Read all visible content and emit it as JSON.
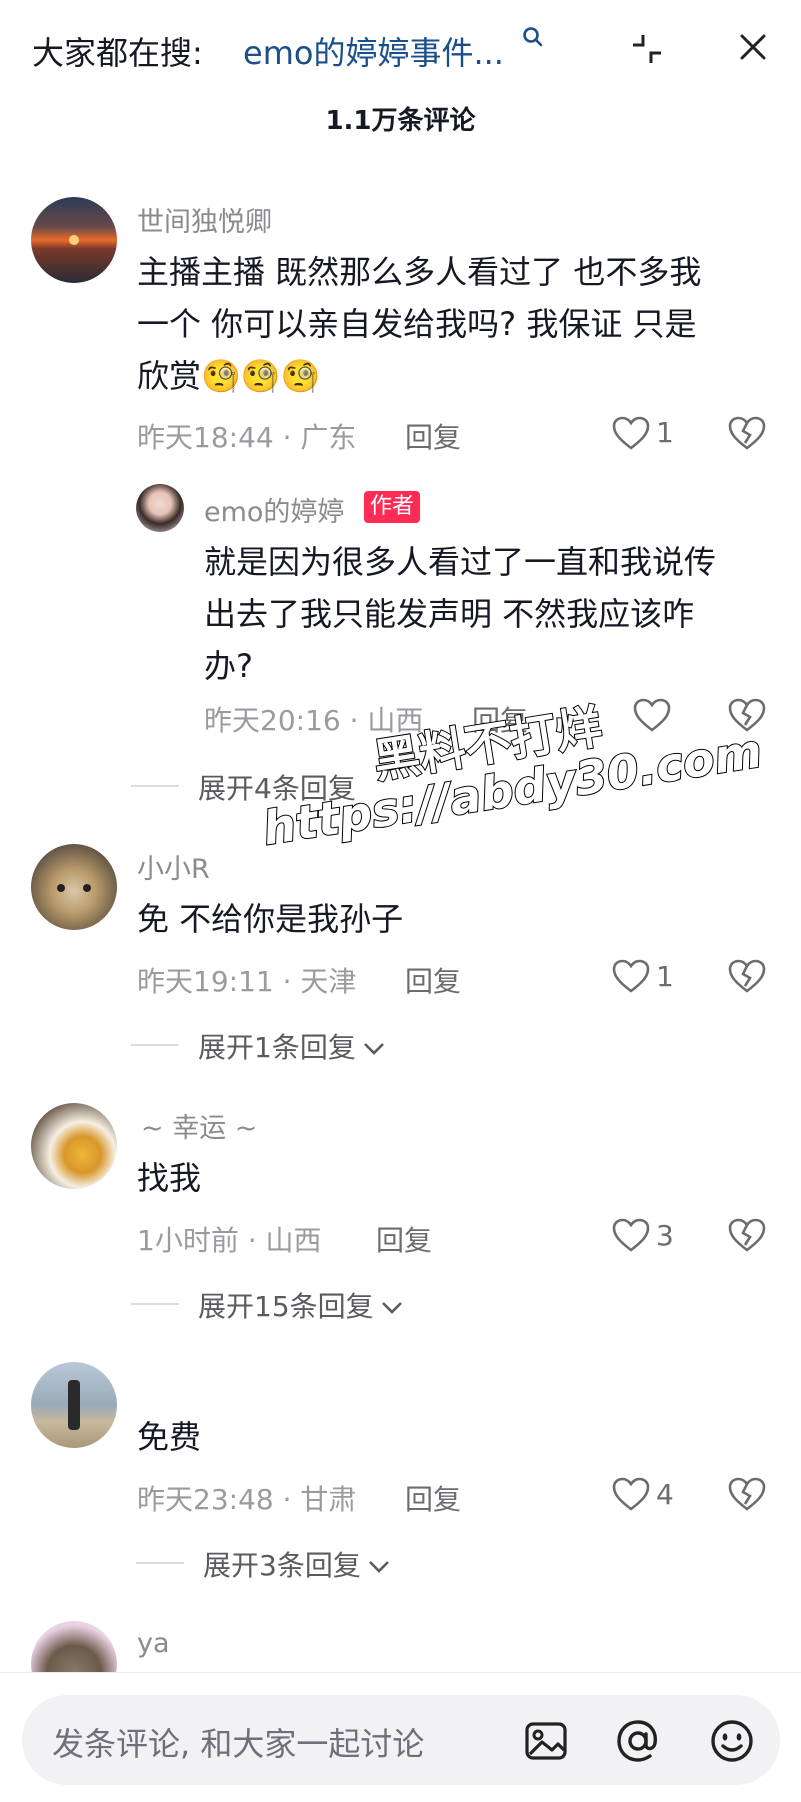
{
  "header": {
    "search_prefix": "大家都在搜:",
    "search_query": "emo的婷婷事件...",
    "search_icon": "search-icon",
    "collapse_icon": "collapse-icon",
    "close_icon": "close-icon",
    "comment_count": "1.1万条评论"
  },
  "comments": [
    {
      "username": "世间独悦卿",
      "text_lines": [
        "主播主播 既然那么多人看过了 也不多我",
        "一个 你可以亲自发给我吗? 我保证 只是",
        "欣赏"
      ],
      "emoji": "🧐🧐🧐",
      "meta": "昨天18:44 · 广东",
      "reply": "回复",
      "likes": "1",
      "reply_item": {
        "username": "emo的婷婷",
        "badge": "作者",
        "text_lines": [
          "就是因为很多人看过了一直和我说传",
          "出去了我只能发声明 不然我应该咋",
          "办?"
        ],
        "meta": "昨天20:16 · 山西",
        "reply": "回复",
        "likes": ""
      },
      "expand": "展开4条回复"
    },
    {
      "username": "小小R",
      "text": "免 不给你是我孙子",
      "meta": "昨天19:11 · 天津",
      "reply": "回复",
      "likes": "1",
      "expand": "展开1条回复"
    },
    {
      "username": "~ 幸运 ~",
      "text": "找我",
      "meta": "1小时前 · 山西",
      "reply": "回复",
      "likes": "3",
      "expand": "展开15条回复"
    },
    {
      "username": "",
      "text": "免费",
      "meta": "昨天23:48 · 甘肃",
      "reply": "回复",
      "likes": "4",
      "expand": "展开3条回复"
    },
    {
      "username": "ya"
    }
  ],
  "watermark": {
    "line1": "黑料不打烊",
    "line2": "https://abdy30.com"
  },
  "footer": {
    "input_placeholder": "发条评论, 和大家一起讨论",
    "icons": [
      "image-icon",
      "at-icon",
      "emoji-icon"
    ]
  },
  "colors": {
    "accent": "#fe2c55",
    "search_link": "#1b4f8a"
  }
}
